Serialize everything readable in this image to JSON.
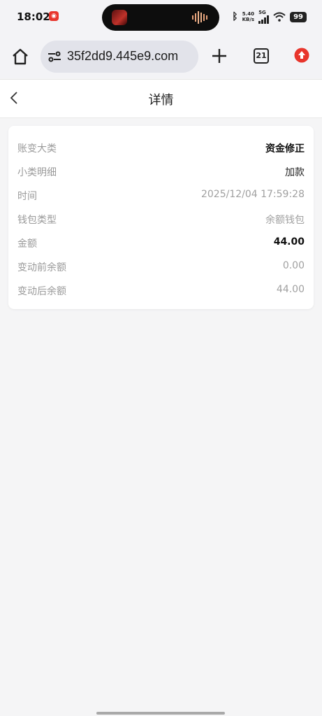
{
  "status_bar": {
    "time": "18:02",
    "net_speed_value": "5.40",
    "net_speed_unit": "KB/s",
    "network_type": "5G",
    "battery": "99"
  },
  "browser": {
    "url": "35f2dd9.445e9.com",
    "tabs_count": "21"
  },
  "header": {
    "title": "详情"
  },
  "details": [
    {
      "label": "账变大类",
      "value": "资金修正",
      "style": "strong"
    },
    {
      "label": "小类明细",
      "value": "加款",
      "style": "dark"
    },
    {
      "label": "时间",
      "value": "2025/12/04 17:59:28",
      "style": "muted"
    },
    {
      "label": "钱包类型",
      "value": "余额钱包",
      "style": "muted"
    },
    {
      "label": "金额",
      "value": "44.00",
      "style": "strong"
    },
    {
      "label": "变动前余额",
      "value": "0.00",
      "style": "muted"
    },
    {
      "label": "变动后余额",
      "value": "44.00",
      "style": "muted"
    }
  ],
  "colors": {
    "background": "#f5f5f6",
    "card": "#ffffff",
    "label": "#9a9a9a",
    "upgrade_badge": "#e8352c"
  }
}
